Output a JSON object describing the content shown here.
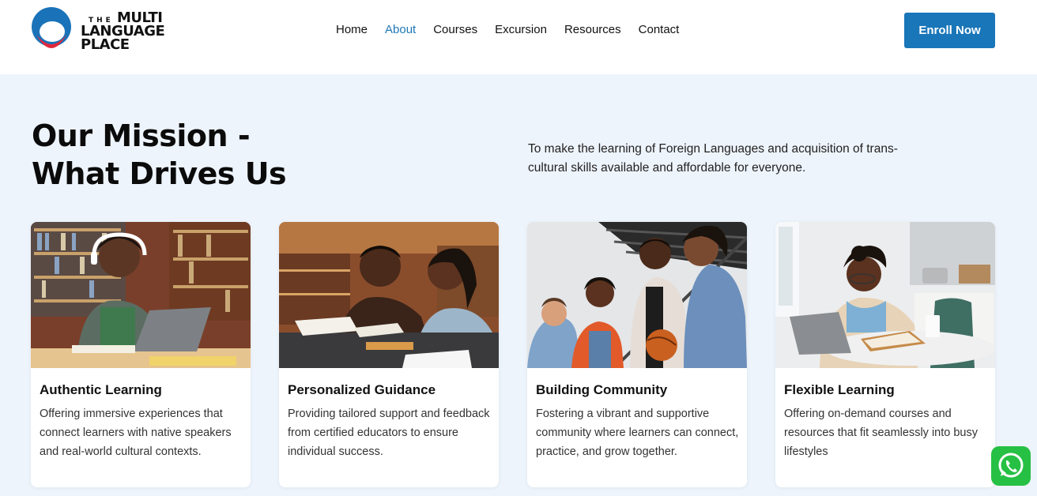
{
  "brand": {
    "line_the": "THE",
    "line1": "MULTI",
    "line2": "LANGUAGE",
    "line3": "PLACE",
    "logo_icon": "circle-logo-icon",
    "colors": {
      "blue": "#1a73b8",
      "red": "#e0283c"
    }
  },
  "nav": {
    "items": [
      {
        "label": "Home",
        "active": false
      },
      {
        "label": "About",
        "active": true
      },
      {
        "label": "Courses",
        "active": false
      },
      {
        "label": "Excursion",
        "active": false
      },
      {
        "label": "Resources",
        "active": false
      },
      {
        "label": "Contact",
        "active": false
      }
    ],
    "active_color": "#1f78b4"
  },
  "header": {
    "enroll_label": "Enroll Now",
    "enroll_color": "#1976b9"
  },
  "mission": {
    "title_line1": "Our Mission -",
    "title_line2": "What Drives Us",
    "text": "To make the learning of Foreign Languages and acquisition of trans-cultural skills available and affordable for everyone."
  },
  "cards": [
    {
      "title": "Authentic Learning",
      "desc": "Offering immersive experiences that connect learners with native speakers and real-world cultural contexts.",
      "image": "student-laptop-library-photo"
    },
    {
      "title": "Personalized Guidance",
      "desc": "Providing tailored support and feedback from certified educators to ensure individual success.",
      "image": "tutor-helping-student-photo"
    },
    {
      "title": "Building Community",
      "desc": "Fostering a vibrant and supportive community where learners can connect, practice, and grow together.",
      "image": "group-of-friends-stairs-photo"
    },
    {
      "title": "Flexible Learning",
      "desc": "Offering on-demand courses and resources that fit seamlessly into busy lifestyles",
      "image": "woman-studying-kitchen-photo"
    }
  ],
  "whatsapp": {
    "icon": "whatsapp-icon",
    "color": "#26c044"
  }
}
